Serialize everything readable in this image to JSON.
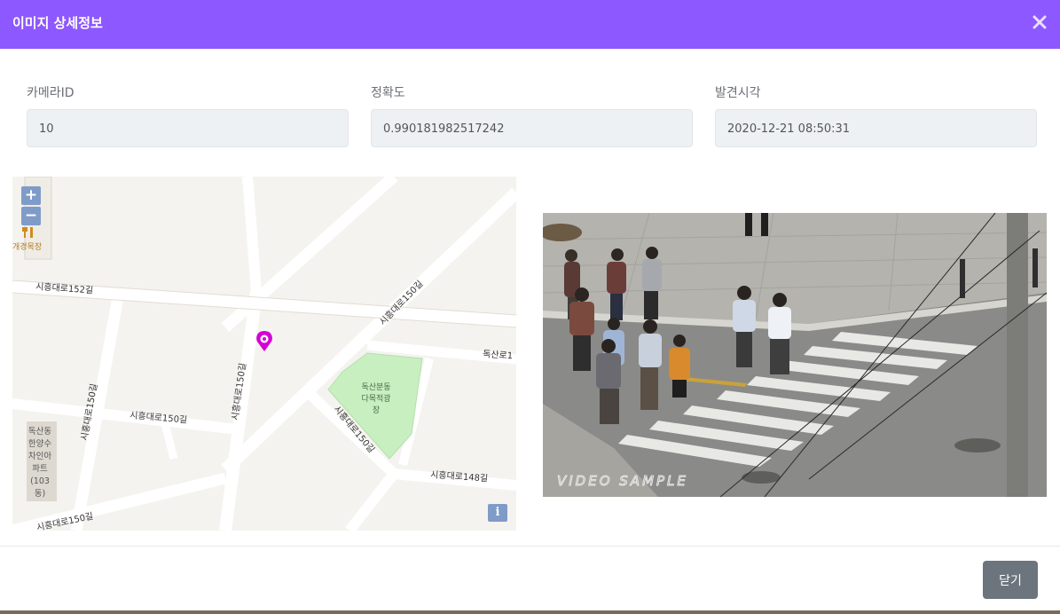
{
  "modal": {
    "title": "이미지 상세정보"
  },
  "fields": {
    "camera_id": {
      "label": "카메라ID",
      "value": "10"
    },
    "accuracy": {
      "label": "정확도",
      "value": "0.990181982517242"
    },
    "detected_time": {
      "label": "발견시각",
      "value": "2020-12-21 08:50:31"
    }
  },
  "map": {
    "zoom_in": "+",
    "zoom_out": "−",
    "info": "i",
    "labels": {
      "restaurant": "개경목장",
      "road_152": "시흥대로152길",
      "road_150_diag": "시흥대로150길",
      "road_150_vert": "시흥대로150길",
      "road_150_left": "시흥대로150길",
      "road_150_mid": "시흥대로150길",
      "road_150_lower": "시흥대로150길",
      "road_150_bottom": "시흥대로150길",
      "road_148": "시흥대로148길",
      "doksan_ro": "독산로1",
      "park_line1": "독산분동",
      "park_line2": "다목적광",
      "park_line3": "장",
      "apt_line1": "독산동",
      "apt_line2": "한양수",
      "apt_line3": "차인아",
      "apt_line4": "파트",
      "apt_line5": "(103",
      "apt_line6": "동)"
    }
  },
  "photo": {
    "watermark": "VIDEO SAMPLE"
  },
  "footer": {
    "close_label": "닫기"
  },
  "colors": {
    "header": "#8d58ff",
    "close_button": "#6c757d",
    "marker": "#d400d4",
    "park": "#c8efc0"
  }
}
